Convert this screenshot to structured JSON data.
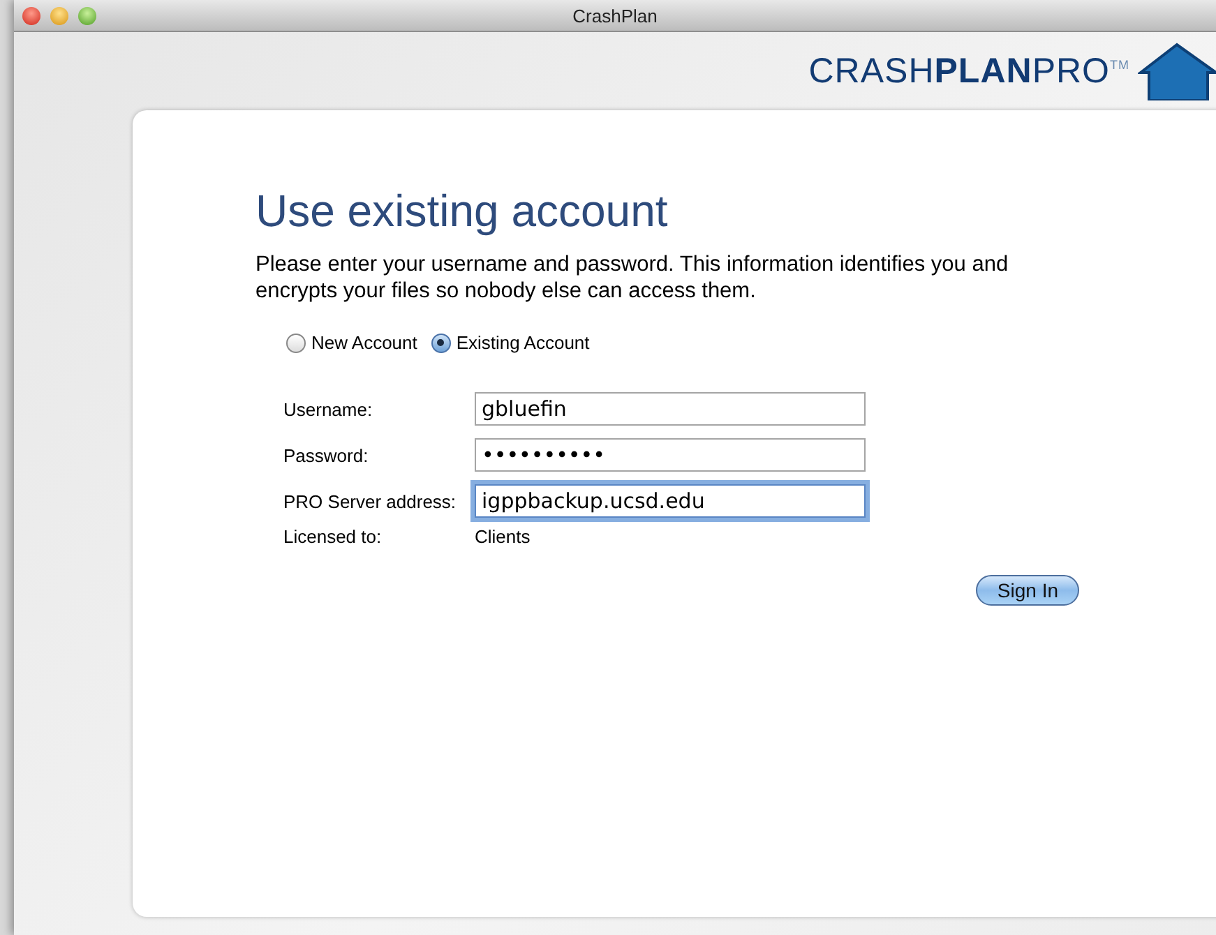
{
  "window": {
    "title": "CrashPlan"
  },
  "logo": {
    "text": "CRASH**PLAN**PRO$^{TM}$"
  },
  "heading": "Use existing account",
  "description": "Please enter your username and password. This information identifies you and encrypts your files so nobody else can access them.",
  "account_types": [
    {
      "label": "New Account",
      "selected": false
    },
    {
      "label": "Existing Account",
      "selected": true
    }
  ],
  "fields": [
    {
      "label": "Username:",
      "value": "gbluefin",
      "focused": false
    },
    {
      "label": "Password:",
      "value": "••••••••••",
      "focused": false
    },
    {
      "label": "PRO Server address:",
      "value": "igppbackup.ucsd.edu",
      "focused": true
    }
  ],
  "licensed": {
    "label": "Licensed to:",
    "value": "Clients"
  },
  "sign_in_button": "Sign In"
}
